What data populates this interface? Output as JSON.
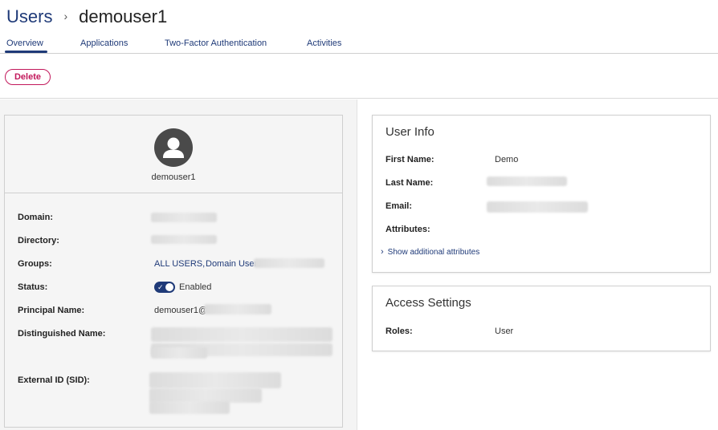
{
  "breadcrumb": {
    "root": "Users",
    "separator": "›",
    "current": "demouser1"
  },
  "tabs": [
    {
      "label": "Overview",
      "active": true
    },
    {
      "label": "Applications",
      "active": false
    },
    {
      "label": "Two-Factor Authentication",
      "active": false
    },
    {
      "label": "Activities",
      "active": false
    }
  ],
  "actions": {
    "delete_label": "Delete"
  },
  "profile": {
    "avatar_icon": "user-avatar-icon",
    "username": "demouser1",
    "fields": {
      "domain_label": "Domain:",
      "directory_label": "Directory:",
      "groups_label": "Groups:",
      "groups": [
        "ALL USERS,",
        "Domain Users"
      ],
      "status_label": "Status:",
      "status_value": "Enabled",
      "status_enabled": true,
      "principal_label": "Principal Name:",
      "principal_value": "demouser1@",
      "distinguished_label": "Distinguished Name:",
      "external_id_label": "External ID (SID):"
    }
  },
  "user_info": {
    "title": "User Info",
    "first_name_label": "First Name:",
    "first_name_value": "Demo",
    "last_name_label": "Last Name:",
    "email_label": "Email:",
    "attributes_label": "Attributes:",
    "show_more": "Show additional attributes"
  },
  "access_settings": {
    "title": "Access Settings",
    "roles_label": "Roles:",
    "roles_value": "User"
  },
  "colors": {
    "accent": "#1f3a78",
    "danger": "#c2185b"
  }
}
